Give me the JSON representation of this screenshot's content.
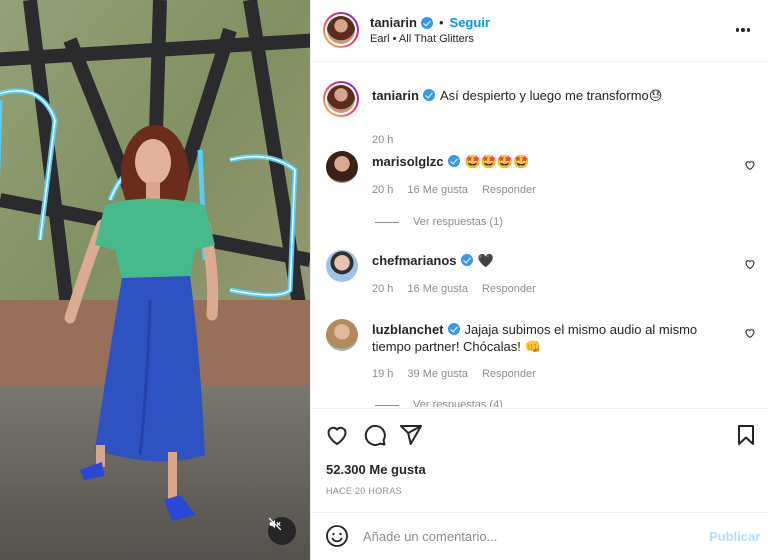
{
  "post": {
    "author": "taniarin",
    "follow_label": "Seguir",
    "separator": "•",
    "audio": "Earl • All That Glitters",
    "caption": "Así despierto y luego me transformo",
    "caption_emoji": "😓",
    "caption_time": "20 h",
    "likes": "52.300 Me gusta",
    "posted_ago": "HACE 20 HORAS"
  },
  "comments": [
    {
      "user": "marisolglzc",
      "verified": true,
      "text": "🤩🤩🤩🤩",
      "time": "20 h",
      "likes": "16 Me gusta",
      "reply_label": "Responder",
      "replies": "Ver respuestas (1)"
    },
    {
      "user": "chefmarianos",
      "verified": true,
      "text": "🖤",
      "time": "20 h",
      "likes": "16 Me gusta",
      "reply_label": "Responder"
    },
    {
      "user": "luzblanchet",
      "verified": true,
      "text": "Jajaja subimos el mismo audio al mismo tiempo partner! Chócalas!",
      "emoji": "👊",
      "time": "19 h",
      "likes": "39 Me gusta",
      "reply_label": "Responder",
      "replies": "Ver respuestas (4)"
    }
  ],
  "composer": {
    "placeholder": "Añade un comentario...",
    "publish_label": "Publicar"
  },
  "icons": {
    "verified": "verified-badge-icon",
    "more": "more-options-icon",
    "like": "heart-icon",
    "comment": "comment-icon",
    "share": "share-icon",
    "save": "bookmark-icon",
    "emoji": "emoji-icon",
    "mute": "muted-audio-icon"
  },
  "colors": {
    "accent": "#0095f6",
    "verified": "#3897f0",
    "publish_disabled": "#b2dffc",
    "muted_text": "#8e8e8e"
  }
}
